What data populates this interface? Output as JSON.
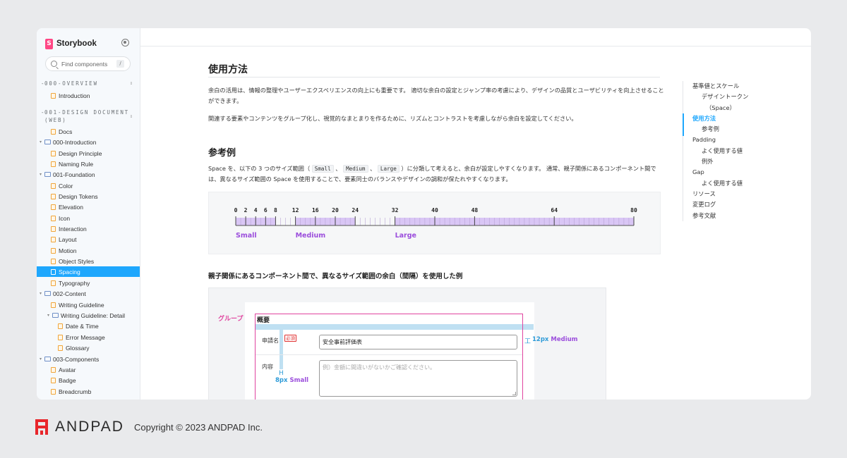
{
  "sidebar": {
    "app_title": "Storybook",
    "search_placeholder": "Find components",
    "search_shortcut": "/",
    "groups": [
      {
        "label": "000-OVERVIEW"
      },
      {
        "label": "001-DESIGN DOCUMENT (WEB)"
      }
    ],
    "items": [
      {
        "label": "Introduction",
        "type": "doc"
      },
      {
        "label": "Docs",
        "type": "doc"
      },
      {
        "label": "000-Introduction",
        "type": "folder"
      },
      {
        "label": "Design Principle",
        "type": "doc"
      },
      {
        "label": "Naming Rule",
        "type": "doc"
      },
      {
        "label": "001-Foundation",
        "type": "folder"
      },
      {
        "label": "Color",
        "type": "doc"
      },
      {
        "label": "Design Tokens",
        "type": "doc"
      },
      {
        "label": "Elevation",
        "type": "doc"
      },
      {
        "label": "Icon",
        "type": "doc"
      },
      {
        "label": "Interaction",
        "type": "doc"
      },
      {
        "label": "Layout",
        "type": "doc"
      },
      {
        "label": "Motion",
        "type": "doc"
      },
      {
        "label": "Object Styles",
        "type": "doc"
      },
      {
        "label": "Spacing",
        "type": "doc",
        "active": true
      },
      {
        "label": "Typography",
        "type": "doc"
      },
      {
        "label": "002-Content",
        "type": "folder"
      },
      {
        "label": "Writing Guideline",
        "type": "doc"
      },
      {
        "label": "Writing Guideline: Detail",
        "type": "folder"
      },
      {
        "label": "Date & Time",
        "type": "doc"
      },
      {
        "label": "Error Message",
        "type": "doc"
      },
      {
        "label": "Glossary",
        "type": "doc"
      },
      {
        "label": "003-Components",
        "type": "folder"
      },
      {
        "label": "Avatar",
        "type": "doc"
      },
      {
        "label": "Badge",
        "type": "doc"
      },
      {
        "label": "Breadcrumb",
        "type": "doc"
      }
    ]
  },
  "content": {
    "section1_title": "使用方法",
    "section1_p1": "余白の活用は、情報の整理やユーザーエクスペリエンスの向上にも重要です。 適切な余白の設定とジャンプ率の考慮により、デザインの品質とユーザビリティを向上させることができます。",
    "section1_p2": "関連する要素やコンテンツをグループ化し、視覚的なまとまりを作るために、リズムとコントラストを考慮しながら余白を設定してください。",
    "section2_title": "参考例",
    "section2_p_a": "Space を、以下の 3 つのサイズ範囲（",
    "code_small": "Small",
    "sep1": "、",
    "code_medium": "Medium",
    "sep2": "、",
    "code_large": "Large",
    "section2_p_b": "）に分類して考えると、余白が設定しやすくなります。 通常、親子関係にあるコンポーネント間では、異なるサイズ範囲の Space を使用することで、要素同士のバランスやデザインの調和が保たれやすくなります。",
    "scale": {
      "ticks": [
        0,
        2,
        4,
        6,
        8,
        12,
        16,
        20,
        24,
        32,
        40,
        48,
        64,
        80
      ],
      "ranges": [
        {
          "label": "Small",
          "from": 0,
          "to": 8
        },
        {
          "label": "Medium",
          "from": 12,
          "to": 24
        },
        {
          "label": "Large",
          "from": 32,
          "to": 80
        }
      ],
      "color_fill": "#d9c6f5",
      "color_label": "#9b4ddc"
    },
    "example_title": "親子関係にあるコンポーネント間で、異なるサイズ範囲の余白（間隔）を使用した例",
    "example": {
      "group_label": "グループ",
      "form_title": "概要",
      "field1_label": "申請名",
      "required_badge": "必須",
      "field1_value": "安全事前評価表",
      "field2_label": "内容",
      "field2_placeholder": "例）金額に間違いがないかご確認ください。",
      "ann_medium_value": "12px",
      "ann_medium_label": "Medium",
      "ann_small_value": "8px",
      "ann_small_label": "Small"
    }
  },
  "toc": [
    {
      "label": "基準値とスケール",
      "level": 1
    },
    {
      "label": "デザイントークン",
      "level": 2
    },
    {
      "label": "（Space）",
      "level": 3
    },
    {
      "label": "使用方法",
      "level": 1,
      "active": true
    },
    {
      "label": "参考例",
      "level": 2
    },
    {
      "label": "Padding",
      "level": 1
    },
    {
      "label": "よく使用する値",
      "level": 2
    },
    {
      "label": "例外",
      "level": 2
    },
    {
      "label": "Gap",
      "level": 1
    },
    {
      "label": "よく使用する値",
      "level": 2
    },
    {
      "label": "リソース",
      "level": 1
    },
    {
      "label": "変更ログ",
      "level": 1
    },
    {
      "label": "参考文献",
      "level": 1
    }
  ],
  "footer": {
    "brand": "ANDPAD",
    "copyright": "Copyright © 2023 ANDPAD Inc.",
    "brand_color": "#e8262b"
  }
}
